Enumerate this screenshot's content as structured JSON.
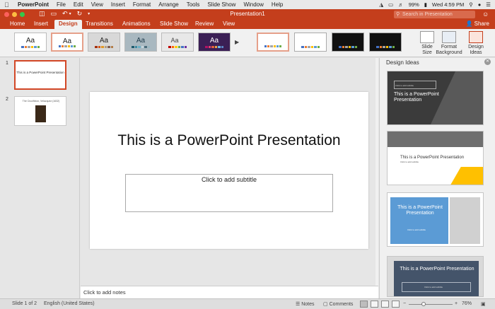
{
  "menubar": {
    "app_name": "PowerPoint",
    "items": [
      "File",
      "Edit",
      "View",
      "Insert",
      "Format",
      "Arrange",
      "Tools",
      "Slide Show",
      "Window",
      "Help"
    ],
    "battery": "99%",
    "clock": "Wed 4:59 PM"
  },
  "titlebar": {
    "doc_title": "Presentation1",
    "search_placeholder": "Search in Presentation"
  },
  "tabs": [
    {
      "label": "Home",
      "active": false
    },
    {
      "label": "Insert",
      "active": false
    },
    {
      "label": "Design",
      "active": true
    },
    {
      "label": "Transitions",
      "active": false
    },
    {
      "label": "Animations",
      "active": false
    },
    {
      "label": "Slide Show",
      "active": false
    },
    {
      "label": "Review",
      "active": false
    },
    {
      "label": "View",
      "active": false
    }
  ],
  "share_label": "Share",
  "ribbon": {
    "themes": [
      {
        "aa": "Aa",
        "bg": "#ffffff",
        "fg": "#222222"
      },
      {
        "aa": "Aa",
        "bg": "#ffffff",
        "fg": "#222222"
      },
      {
        "aa": "Aa",
        "bg": "#d8d8d8",
        "fg": "#222222"
      },
      {
        "aa": "Aa",
        "bg": "#a9b8c0",
        "fg": "#1d3a4a"
      },
      {
        "aa": "Aa",
        "bg": "#e8e8e8",
        "fg": "#444444"
      },
      {
        "aa": "Aa",
        "bg": "#3b1f55",
        "fg": "#ffffff"
      }
    ],
    "buttons": {
      "slide_size": "Slide Size",
      "format_background": "Format Background",
      "design_ideas": "Design Ideas"
    }
  },
  "thumbnails": [
    {
      "num": "1",
      "text": "This is a PowerPoint Presentation"
    },
    {
      "num": "2",
      "text": "The Crucifixion, Velazquez (1632)"
    }
  ],
  "slide": {
    "title": "This is a PowerPoint Presentation",
    "subtitle_placeholder": "Click to add subtitle"
  },
  "notes_placeholder": "Click to add notes",
  "design_panel": {
    "title": "Design Ideas",
    "ideas": [
      {
        "title": "This is a PowerPoint Presentation",
        "sub": "Click to add subtitle"
      },
      {
        "title": "This is a PowerPoint Presentation",
        "sub": "Click to add subtitle"
      },
      {
        "title": "This is a PowerPoint Presentation",
        "sub": "Click to add subtitle"
      },
      {
        "title": "This is a PowerPoint Presentation",
        "sub": "Click to add subtitle"
      }
    ]
  },
  "statusbar": {
    "slide_count": "Slide 1 of 2",
    "language": "English (United States)",
    "notes_label": "Notes",
    "comments_label": "Comments",
    "zoom": "76%"
  },
  "colors": {
    "accent": "#c43e1c",
    "ribbon_bg": "#f1f1f1",
    "status_bg": "#dedede"
  }
}
